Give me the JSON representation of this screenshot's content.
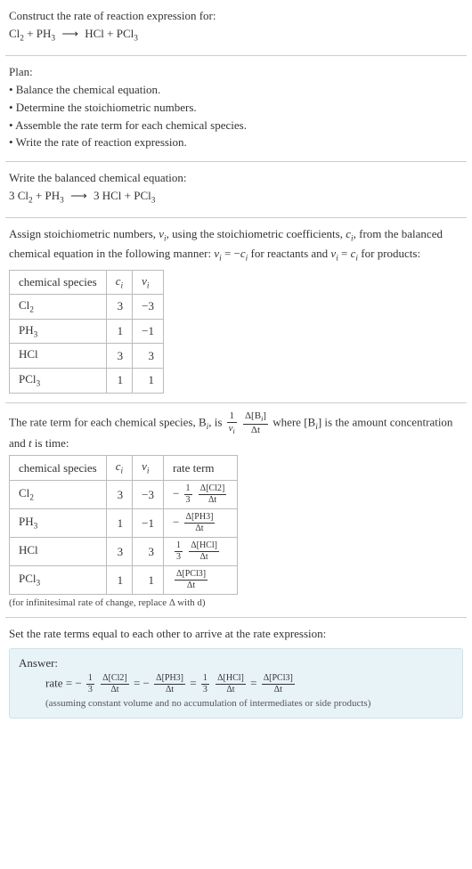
{
  "intro": {
    "prompt": "Construct the rate of reaction expression for:",
    "eq_lhs1": "Cl",
    "eq_lhs1_sub": "2",
    "eq_plus1": " + PH",
    "eq_lhs2_sub": "3",
    "eq_arrow": "⟶",
    "eq_rhs1": "HCl + PCl",
    "eq_rhs2_sub": "3"
  },
  "plan": {
    "header": "Plan:",
    "b1": "• Balance the chemical equation.",
    "b2": "• Determine the stoichiometric numbers.",
    "b3": "• Assemble the rate term for each chemical species.",
    "b4": "• Write the rate of reaction expression."
  },
  "balanced": {
    "header": "Write the balanced chemical equation:",
    "lhs_c1": "3 Cl",
    "lhs_c1_sub": "2",
    "lhs_plus": " + PH",
    "lhs_c2_sub": "3",
    "arrow": "⟶",
    "rhs_c1": "3 HCl + PCl",
    "rhs_c2_sub": "3"
  },
  "stoich": {
    "intro_a": "Assign stoichiometric numbers, ",
    "nu": "ν",
    "nu_sub": "i",
    "intro_b": ", using the stoichiometric coefficients, ",
    "c": "c",
    "c_sub": "i",
    "intro_c": ", from the balanced chemical equation in the following manner: ",
    "rel1_a": "ν",
    "rel1_b": " = −",
    "rel1_c": "c",
    "intro_d": " for reactants and ",
    "rel2_a": "ν",
    "rel2_b": " = ",
    "rel2_c": "c",
    "intro_e": " for products:",
    "table": {
      "h1": "chemical species",
      "h2": "c",
      "h2_sub": "i",
      "h3": "ν",
      "h3_sub": "i",
      "rows": [
        {
          "sp": "Cl",
          "sp_sub": "2",
          "c": "3",
          "nu": "−3"
        },
        {
          "sp": "PH",
          "sp_sub": "3",
          "c": "1",
          "nu": "−1"
        },
        {
          "sp": "HCl",
          "sp_sub": "",
          "c": "3",
          "nu": "3"
        },
        {
          "sp": "PCl",
          "sp_sub": "3",
          "c": "1",
          "nu": "1"
        }
      ]
    }
  },
  "rateterm": {
    "intro_a": "The rate term for each chemical species, B",
    "intro_a_sub": "i",
    "intro_b": ", is ",
    "frac1_num": "1",
    "frac1_den_a": "ν",
    "frac1_den_sub": "i",
    "frac2_num_a": "Δ[B",
    "frac2_num_sub": "i",
    "frac2_num_b": "]",
    "frac2_den": "Δt",
    "intro_c": " where [B",
    "intro_c_sub": "i",
    "intro_d": "] is the amount concentration and ",
    "t": "t",
    "intro_e": " is time:",
    "table": {
      "h1": "chemical species",
      "h2": "c",
      "h2_sub": "i",
      "h3": "ν",
      "h3_sub": "i",
      "h4": "rate term",
      "rows": [
        {
          "sp": "Cl",
          "sp_sub": "2",
          "c": "3",
          "nu": "−3",
          "rt_prefix": "−",
          "rt_coef_num": "1",
          "rt_coef_den": "3",
          "rt_num": "Δ[Cl2]",
          "rt_den": "Δt"
        },
        {
          "sp": "PH",
          "sp_sub": "3",
          "c": "1",
          "nu": "−1",
          "rt_prefix": "−",
          "rt_coef_num": "",
          "rt_coef_den": "",
          "rt_num": "Δ[PH3]",
          "rt_den": "Δt"
        },
        {
          "sp": "HCl",
          "sp_sub": "",
          "c": "3",
          "nu": "3",
          "rt_prefix": "",
          "rt_coef_num": "1",
          "rt_coef_den": "3",
          "rt_num": "Δ[HCl]",
          "rt_den": "Δt"
        },
        {
          "sp": "PCl",
          "sp_sub": "3",
          "c": "1",
          "nu": "1",
          "rt_prefix": "",
          "rt_coef_num": "",
          "rt_coef_den": "",
          "rt_num": "Δ[PCl3]",
          "rt_den": "Δt"
        }
      ]
    },
    "note": "(for infinitesimal rate of change, replace Δ with d)"
  },
  "final": {
    "header": "Set the rate terms equal to each other to arrive at the rate expression:",
    "answer_label": "Answer:",
    "rate_lhs": "rate = ",
    "m1": "−",
    "c1_num": "1",
    "c1_den": "3",
    "f1_num": "Δ[Cl2]",
    "f1_den": "Δt",
    "eq": " = ",
    "m2": "−",
    "f2_num": "Δ[PH3]",
    "f2_den": "Δt",
    "c3_num": "1",
    "c3_den": "3",
    "f3_num": "Δ[HCl]",
    "f3_den": "Δt",
    "f4_num": "Δ[PCl3]",
    "f4_den": "Δt",
    "note": "(assuming constant volume and no accumulation of intermediates or side products)"
  },
  "chart_data": {
    "type": "table",
    "title": "Stoichiometric numbers",
    "columns": [
      "chemical species",
      "c_i",
      "ν_i"
    ],
    "rows": [
      [
        "Cl2",
        3,
        -3
      ],
      [
        "PH3",
        1,
        -1
      ],
      [
        "HCl",
        3,
        3
      ],
      [
        "PCl3",
        1,
        1
      ]
    ]
  }
}
